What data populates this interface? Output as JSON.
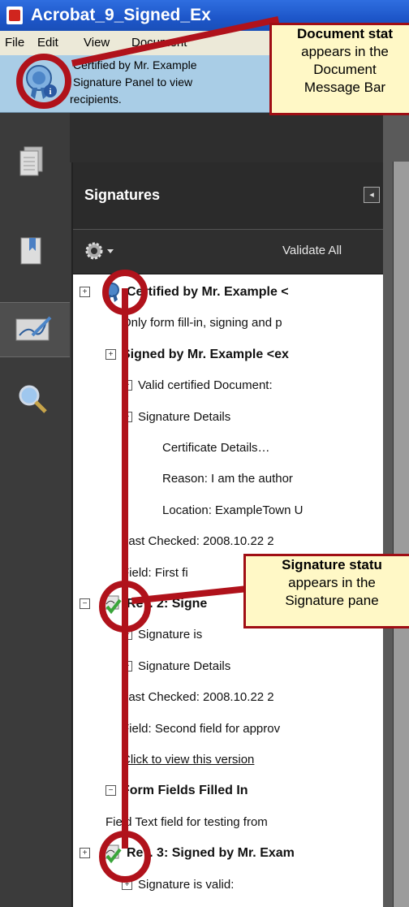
{
  "window": {
    "title": "Acrobat_9_Signed_Ex"
  },
  "menu": {
    "items": [
      "File",
      "Edit",
      "View",
      "Document"
    ]
  },
  "message_bar": {
    "lines": [
      "Certified by Mr. Example",
      "Signature Panel to view",
      "recipients."
    ]
  },
  "panel": {
    "title": "Signatures",
    "collapse_glyph": "◂",
    "validate_all": "Validate All",
    "rows": [
      {
        "text": "Certified by Mr. Example <",
        "indent": 0,
        "bold": true,
        "box": "⊞",
        "icon": "certified-ribbon-icon"
      },
      {
        "text": "Only form fill-in, signing and p",
        "indent": 2,
        "bold": false
      },
      {
        "text": "Signed by Mr. Example <ex",
        "indent": 1,
        "bold": true,
        "box": "⊞"
      },
      {
        "text": "Valid certified Document:",
        "indent": 2,
        "bold": false,
        "box": "+"
      },
      {
        "text": "Signature Details",
        "indent": 2,
        "bold": false,
        "box": "−"
      },
      {
        "text": "Certificate Details…",
        "indent": 3,
        "bold": false
      },
      {
        "text": "Reason: I am the author",
        "indent": 3,
        "bold": false
      },
      {
        "text": "Location: ExampleTown U",
        "indent": 3,
        "bold": false
      },
      {
        "text": "Last Checked: 2008.10.22 2",
        "indent": 2,
        "bold": false
      },
      {
        "text": "Field: First fi",
        "indent": 2,
        "bold": false
      },
      {
        "text": "Rev. 2: Signe",
        "indent": 0,
        "bold": true,
        "box": "⊟",
        "icon": "signature-valid-icon"
      },
      {
        "text": "Signature is",
        "indent": 2,
        "bold": false,
        "box": "+"
      },
      {
        "text": "Signature Details",
        "indent": 2,
        "bold": false,
        "box": "+"
      },
      {
        "text": "Last Checked: 2008.10.22 2",
        "indent": 2,
        "bold": false
      },
      {
        "text": "Field: Second field for approv",
        "indent": 2,
        "bold": false
      },
      {
        "text": "Click to view this version",
        "indent": 2,
        "bold": false,
        "link": true
      },
      {
        "text": "Form Fields Filled In",
        "indent": 1,
        "bold": true,
        "box": "−"
      },
      {
        "text": "Field Text field for testing from",
        "indent": 1,
        "bold": false
      },
      {
        "text": "Rev. 3: Signed by Mr. Exam",
        "indent": 0,
        "bold": true,
        "box": "⊞",
        "icon": "signature-valid-icon"
      },
      {
        "text": "Signature is valid:",
        "indent": 2,
        "bold": false,
        "box": "+"
      }
    ]
  },
  "callouts": {
    "document_status": {
      "title": "Document stat",
      "line1": "appears in the",
      "line2": "Document",
      "line3": "Message Bar"
    },
    "signature_status": {
      "title": "Signature statu",
      "line1": "appears in the",
      "line2": "Signature pane"
    }
  },
  "colors": {
    "callout_border": "#a00e14",
    "ring": "#b0121b",
    "callout_fill": "#fff8c6"
  }
}
